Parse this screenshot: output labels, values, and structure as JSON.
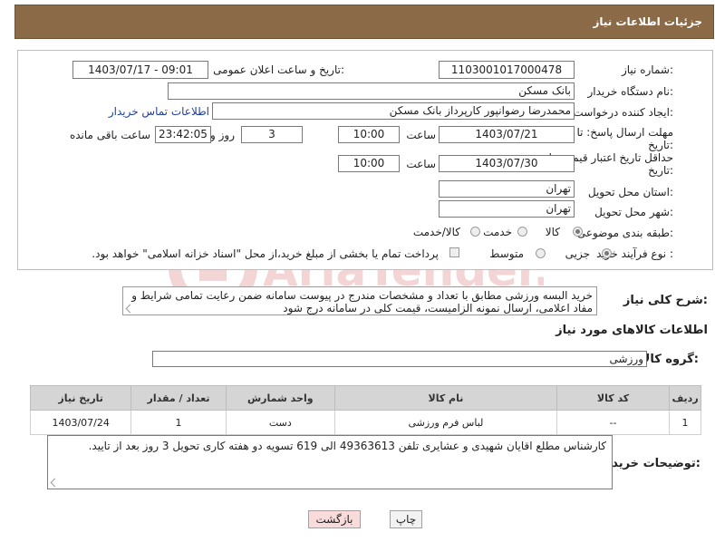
{
  "header": {
    "title": "جزئیات اطلاعات نیاز"
  },
  "form": {
    "need_number_label": "شماره نیاز:",
    "need_number": "1103001017000478",
    "announce_label": "تاریخ و ساعت اعلان عمومی:",
    "announce_value": "1403/07/17 - 09:01",
    "buyer_org_label": "نام دستگاه خریدار:",
    "buyer_org": "بانک مسکن",
    "creator_label": "ایجاد کننده درخواست:",
    "creator": "محمدرضا رضوانپور کارپرداز بانک مسکن",
    "contact_link": "اطلاعات تماس خریدار",
    "deadline_label_1": "مهلت ارسال پاسخ: تا",
    "deadline_label_2": "تاریخ:",
    "deadline_date": "1403/07/21",
    "time_label": "ساعت",
    "deadline_time": "10:00",
    "days_value": "3",
    "days_label": "روز و",
    "remaining_time": "23:42:05",
    "remaining_label": "ساعت باقی مانده",
    "validity_label_1": "حداقل تاریخ اعتبار قیمت: تا",
    "validity_label_2": "تاریخ:",
    "validity_date": "1403/07/30",
    "validity_time": "10:00",
    "province_label": "استان محل تحویل:",
    "province": "تهران",
    "city_label": "شهر محل تحویل:",
    "city": "تهران",
    "category_label": "طبقه بندی موضوعی:",
    "category_options": [
      "کالا",
      "خدمت",
      "کالا/خدمت"
    ],
    "purchase_label": "نوع فرآیند خرید :",
    "purchase_options": [
      "جزیی",
      "متوسط"
    ],
    "payment_note": "پرداخت تمام یا بخشی از مبلغ خرید،از محل \"اسناد خزانه اسلامی\" خواهد بود."
  },
  "description": {
    "label": "شرح کلی نیاز:",
    "text": "خرید البسه ورزشی مطابق با تعداد و مشخصات مندرج در پیوست سامانه ضمن رعایت تمامی شرایط و مفاد اعلامی، ارسال نمونه الزامیست، قیمت کلی در سامانه درج شود"
  },
  "goods": {
    "section_title": "اطلاعات کالاهای مورد نیاز",
    "group_label": "گروه کالا:",
    "group_value": "ورزشی",
    "columns": [
      "ردیف",
      "کد کالا",
      "نام کالا",
      "واحد شمارش",
      "تعداد / مقدار",
      "تاریخ نیاز"
    ],
    "rows": [
      [
        "1",
        "--",
        "لباس فرم ورزشی",
        "دست",
        "1",
        "1403/07/24"
      ]
    ]
  },
  "buyer_notes": {
    "label": "توضیحات خریدار:",
    "text": "کارشناس مطلع اقایان شهیدی و عشایری تلفن 49363613 الی 619 تسویه دو هفته کاری تحویل 3 روز بعد از تایید."
  },
  "buttons": {
    "print": "چاپ",
    "back": "بازگشت"
  },
  "watermark": {
    "text": "AriaTender.neT"
  }
}
